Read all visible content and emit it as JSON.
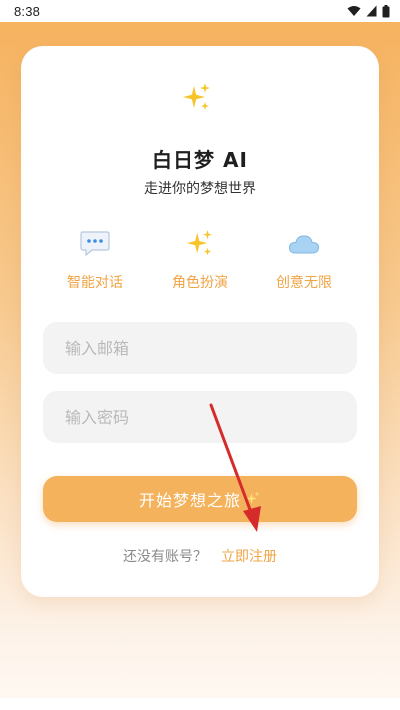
{
  "status_bar": {
    "time": "8:38",
    "icons": [
      "wifi-icon",
      "signal-icon",
      "battery-icon"
    ]
  },
  "app": {
    "title": "白日梦 AI",
    "subtitle": "走进你的梦想世界",
    "logo_icon": "sparkles-icon"
  },
  "features": [
    {
      "label": "智能对话",
      "icon": "chat-bubble-icon"
    },
    {
      "label": "角色扮演",
      "icon": "sparkles-icon"
    },
    {
      "label": "创意无限",
      "icon": "cloud-icon"
    }
  ],
  "form": {
    "email_placeholder": "输入邮箱",
    "password_placeholder": "输入密码",
    "submit_label": "开始梦想之旅",
    "submit_icon": "sparkles-icon"
  },
  "register": {
    "question": "还没有账号？",
    "link_label": "立即注册"
  },
  "colors": {
    "accent": "#f5b25c",
    "accent_text": "#f0a444",
    "annotation_arrow": "#d62b2b"
  }
}
